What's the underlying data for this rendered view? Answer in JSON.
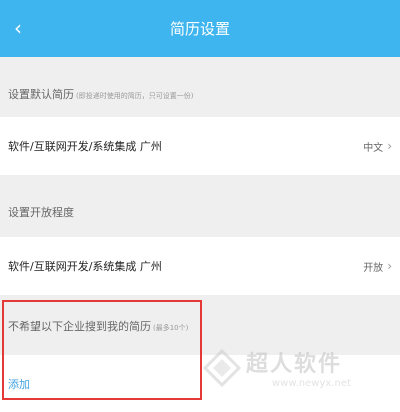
{
  "header": {
    "title": "简历设置",
    "back_icon": "chevron-left-icon"
  },
  "default_resume": {
    "label": "设置默认简历",
    "sub": "(即投递时使用的简历，只可设置一份)",
    "item_name": "软件/互联网开发/系统集成 广州",
    "item_value": "中文"
  },
  "open_level": {
    "label": "设置开放程度",
    "item_name": "软件/互联网开发/系统集成 广州",
    "item_value": "开放"
  },
  "block_companies": {
    "label": "不希望以下企业搜到我的简历",
    "sub": "(最多10个)",
    "add_label": "添加"
  },
  "watermark": {
    "brand": "超人软件",
    "url": "www.newyx.net"
  },
  "colors": {
    "accent": "#3fb5ef",
    "link": "#3fa2e0",
    "highlight": "#e53935"
  }
}
